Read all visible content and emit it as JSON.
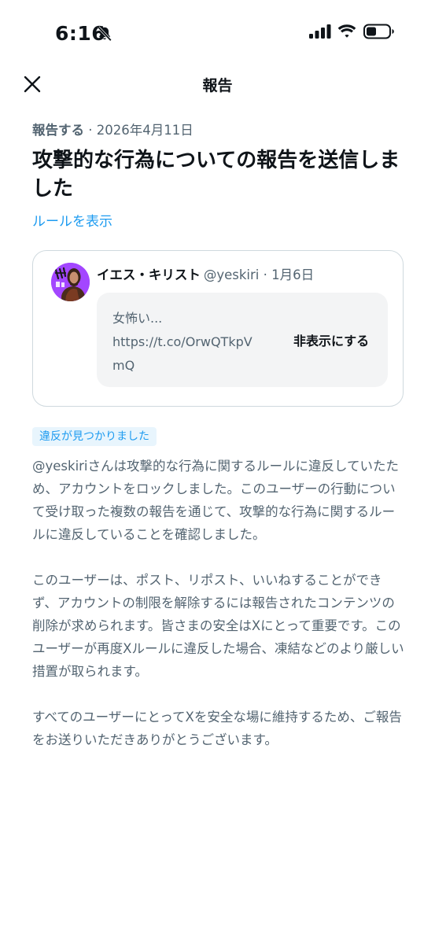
{
  "status_bar": {
    "time": "6:16",
    "icons": [
      "bell-slash-icon",
      "cellular-signal-icon",
      "wifi-icon",
      "battery-icon"
    ]
  },
  "header": {
    "title": "報告",
    "close_icon": "close-icon"
  },
  "report": {
    "type_label": "報告する",
    "separator": " · ",
    "date": "2026年4月11日",
    "headline": "攻撃的な行為についての報告を送信しました",
    "rules_link": "ルールを表示"
  },
  "post": {
    "author_name": "イエス・キリスト",
    "handle": "@yeskiri",
    "separator": " · ",
    "date": "1月6日",
    "hidden_text_lines": [
      "女怖い...",
      "https://t.co/OrwQTkpV",
      "mQ"
    ],
    "reveal_button": "非表示にする"
  },
  "result": {
    "badge": "違反が見つかりました",
    "paragraphs": [
      "@yeskiriさんは攻撃的な行為に関するルールに違反していたため、アカウントをロックしました。このユーザーの行動について受け取った複数の報告を通じて、攻撃的な行為に関するルールに違反していることを確認しました。",
      "このユーザーは、ポスト、リポスト、いいねすることができず、アカウントの制限を解除するには報告されたコンテンツの削除が求められます。皆さまの安全はXにとって重要です。このユーザーが再度Xルールに違反した場合、凍結などのより厳しい措置が取られます。",
      "すべてのユーザーにとってXを安全な場に維持するため、ご報告をお送りいただきありがとうございます。"
    ]
  },
  "colors": {
    "text_primary": "#0f1419",
    "text_secondary": "#536471",
    "link": "#1d9bf0",
    "badge_bg": "#e8f5fd",
    "card_border": "#cfd9de",
    "hidden_box_bg": "#f3f4f5"
  }
}
